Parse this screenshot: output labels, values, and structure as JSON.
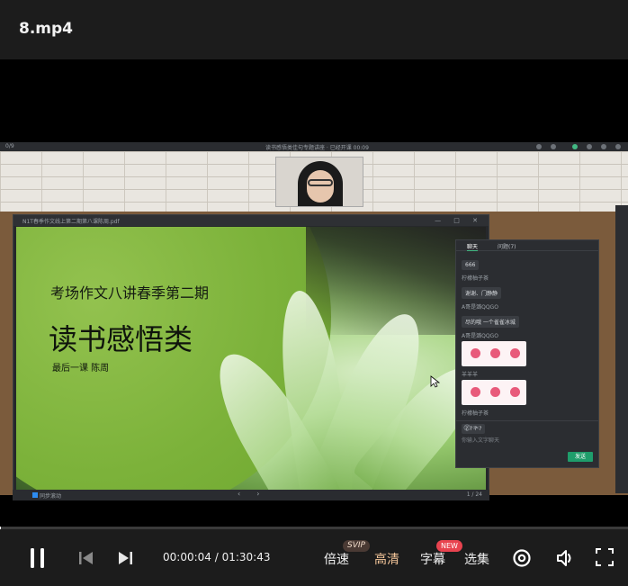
{
  "player": {
    "title": "8.mp4",
    "progress_fraction": 0.0007
  },
  "video_frame": {
    "app_caption": "读书感悟类佳句专题讲座 · 已经开课 00:09",
    "app_left": "0/9",
    "pdf_window": {
      "title": "N1T春季作文线上第二期第八课陈周.pdf",
      "sync_label": "同步滚动",
      "page_indicator": "1 / 24"
    },
    "slide": {
      "line1": "考场作文八讲春季第二期",
      "line2": "读书感悟类",
      "line3": "最后一课  陈周"
    },
    "chat": {
      "tabs": [
        "聊天",
        "问题(7)"
      ],
      "messages": [
        {
          "name": "",
          "text": "666"
        },
        {
          "name": "柠檬柚子茶",
          "text": "谢谢、门静静"
        },
        {
          "name": "A哥是潞QQGO",
          "text": "尽的哦 一个雀雀冰城"
        },
        {
          "name": "A哥是潞QQGO",
          "card": true
        },
        {
          "name": "羊羊羊",
          "card": true
        },
        {
          "name": "柠檬柚子茶",
          "text": "? ? ? ?"
        }
      ],
      "input_placeholder": "你输入文字聊天",
      "send_label": "发送"
    }
  },
  "controls": {
    "time_current": "00:00:04",
    "time_separator": " / ",
    "time_total": "01:30:43",
    "speed_label": "倍速",
    "speed_badge": "SVIP",
    "quality_label": "高清",
    "subtitle_label": "字幕",
    "subtitle_badge": "NEW",
    "episodes_label": "选集",
    "icons": {
      "play_pause": "pause-icon",
      "previous": "skip-previous-icon",
      "next": "skip-next-icon",
      "settings": "settings-ring-icon",
      "volume": "volume-icon",
      "fullscreen": "fullscreen-icon"
    },
    "colors": {
      "quality_highlight": "#f4c69a",
      "svip_badge": "#4a3a34",
      "new_badge": "#e8434f"
    }
  }
}
